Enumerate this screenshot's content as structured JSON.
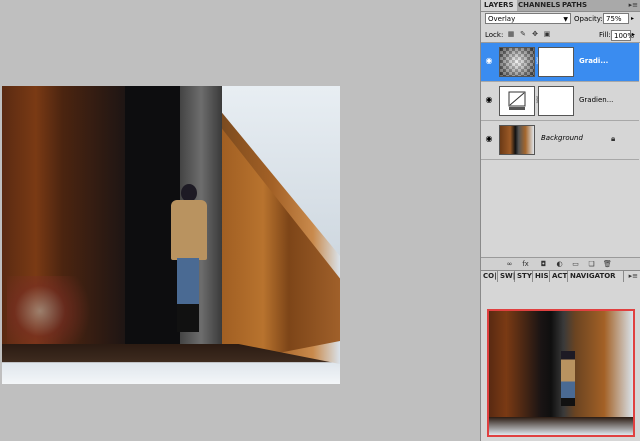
{
  "layers_panel": {
    "tabs": [
      "LAYERS",
      "CHANNELS",
      "PATHS"
    ],
    "blend_mode": "Overlay",
    "opacity_label": "Opacity:",
    "opacity_value": "75%",
    "lock_label": "Lock:",
    "fill_label": "Fill:",
    "fill_value": "100%",
    "layers": [
      {
        "name": "Gradi...",
        "selected": true
      },
      {
        "name": "Gradien...",
        "selected": false
      },
      {
        "name": "Background",
        "selected": false
      }
    ]
  },
  "bottom_panel": {
    "tabs": [
      "CO|",
      "SW|",
      "STY",
      "HIS",
      "ACT",
      "NAVIGATOR"
    ]
  },
  "colors": {
    "selection": "#3a8cf0",
    "navigator_frame": "#e04040",
    "panel_bg": "#d6d6d6",
    "canvas_bg": "#bfbfbf"
  }
}
